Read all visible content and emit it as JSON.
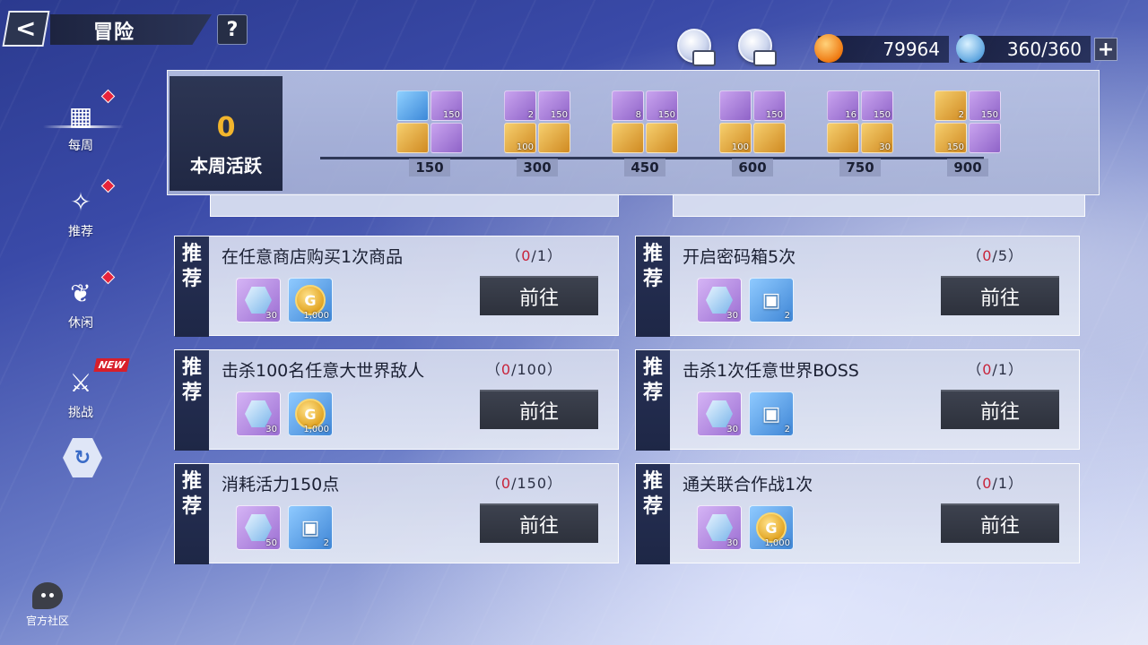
{
  "header": {
    "title": "冒险",
    "help_label": "?",
    "back_label": "<"
  },
  "currencies": [
    {
      "icon": "orange-crystal-icon",
      "value": "79964"
    },
    {
      "icon": "stamina-gear-icon",
      "value": "360/360"
    }
  ],
  "plus_label": "+",
  "nav": [
    {
      "label": "每周",
      "icon": "calendar-icon",
      "badge": "red-dot"
    },
    {
      "label": "推荐",
      "icon": "sparkle-hand-icon",
      "badge": "red-dot"
    },
    {
      "label": "休闲",
      "icon": "leaf-icon",
      "badge": "red-dot"
    },
    {
      "label": "挑战",
      "icon": "crossed-swords-icon",
      "badge": "NEW"
    }
  ],
  "community_label": "官方社区",
  "activity": {
    "count": "0",
    "label": "本周活跃",
    "milestones": [
      {
        "points": "150",
        "items": [
          {
            "c": "blue",
            "q": ""
          },
          {
            "c": "purple",
            "q": "150"
          },
          {
            "c": "gold",
            "q": ""
          },
          {
            "c": "purple",
            "q": ""
          }
        ]
      },
      {
        "points": "300",
        "items": [
          {
            "c": "purple",
            "q": "2"
          },
          {
            "c": "purple",
            "q": "150"
          },
          {
            "c": "gold",
            "q": "100"
          },
          {
            "c": "gold",
            "q": ""
          }
        ]
      },
      {
        "points": "450",
        "items": [
          {
            "c": "purple",
            "q": "8"
          },
          {
            "c": "purple",
            "q": "150"
          },
          {
            "c": "gold",
            "q": ""
          },
          {
            "c": "gold",
            "q": ""
          }
        ]
      },
      {
        "points": "600",
        "items": [
          {
            "c": "purple",
            "q": ""
          },
          {
            "c": "purple",
            "q": "150"
          },
          {
            "c": "gold",
            "q": "100"
          },
          {
            "c": "gold",
            "q": ""
          }
        ]
      },
      {
        "points": "750",
        "items": [
          {
            "c": "purple",
            "q": "16"
          },
          {
            "c": "purple",
            "q": "150"
          },
          {
            "c": "gold",
            "q": ""
          },
          {
            "c": "gold",
            "q": "30"
          }
        ]
      },
      {
        "points": "900",
        "items": [
          {
            "c": "gold",
            "q": "2"
          },
          {
            "c": "purple",
            "q": "150"
          },
          {
            "c": "gold",
            "q": "150"
          },
          {
            "c": "purple",
            "q": ""
          }
        ]
      }
    ]
  },
  "tasks": [
    {
      "tag": "推荐",
      "title": "在任意商店购买1次商品",
      "progress_open": "（",
      "current": "0",
      "total": "/1）",
      "button": "前往",
      "rewards": [
        {
          "type": "gem",
          "color": "purple",
          "qty": "30"
        },
        {
          "type": "coin",
          "color": "blue",
          "qty": "1,000"
        }
      ]
    },
    {
      "tag": "推荐",
      "title": "开启密码箱5次",
      "progress_open": "（",
      "current": "0",
      "total": "/5）",
      "button": "前往",
      "rewards": [
        {
          "type": "gem",
          "color": "purple",
          "qty": "30"
        },
        {
          "type": "box",
          "color": "blue",
          "qty": "2"
        }
      ]
    },
    {
      "tag": "推荐",
      "title": "击杀100名任意大世界敌人",
      "progress_open": "（",
      "current": "0",
      "total": "/100）",
      "button": "前往",
      "rewards": [
        {
          "type": "gem",
          "color": "purple",
          "qty": "30"
        },
        {
          "type": "coin",
          "color": "blue",
          "qty": "1,000"
        }
      ]
    },
    {
      "tag": "推荐",
      "title": "击杀1次任意世界BOSS",
      "progress_open": "（",
      "current": "0",
      "total": "/1）",
      "button": "前往",
      "rewards": [
        {
          "type": "gem",
          "color": "purple",
          "qty": "30"
        },
        {
          "type": "box",
          "color": "blue",
          "qty": "2"
        }
      ]
    },
    {
      "tag": "推荐",
      "title": "消耗活力150点",
      "progress_open": "（",
      "current": "0",
      "total": "/150）",
      "button": "前往",
      "rewards": [
        {
          "type": "gem",
          "color": "purple",
          "qty": "50"
        },
        {
          "type": "box",
          "color": "blue",
          "qty": "2"
        }
      ]
    },
    {
      "tag": "推荐",
      "title": "通关联合作战1次",
      "progress_open": "（",
      "current": "0",
      "total": "/1）",
      "button": "前往",
      "rewards": [
        {
          "type": "gem",
          "color": "purple",
          "qty": "30"
        },
        {
          "type": "coin",
          "color": "blue",
          "qty": "1,000"
        }
      ]
    }
  ],
  "colors": {
    "accent_red": "#c8233a",
    "panel_dark": "#1e2746",
    "gold": "#f2b52d"
  }
}
